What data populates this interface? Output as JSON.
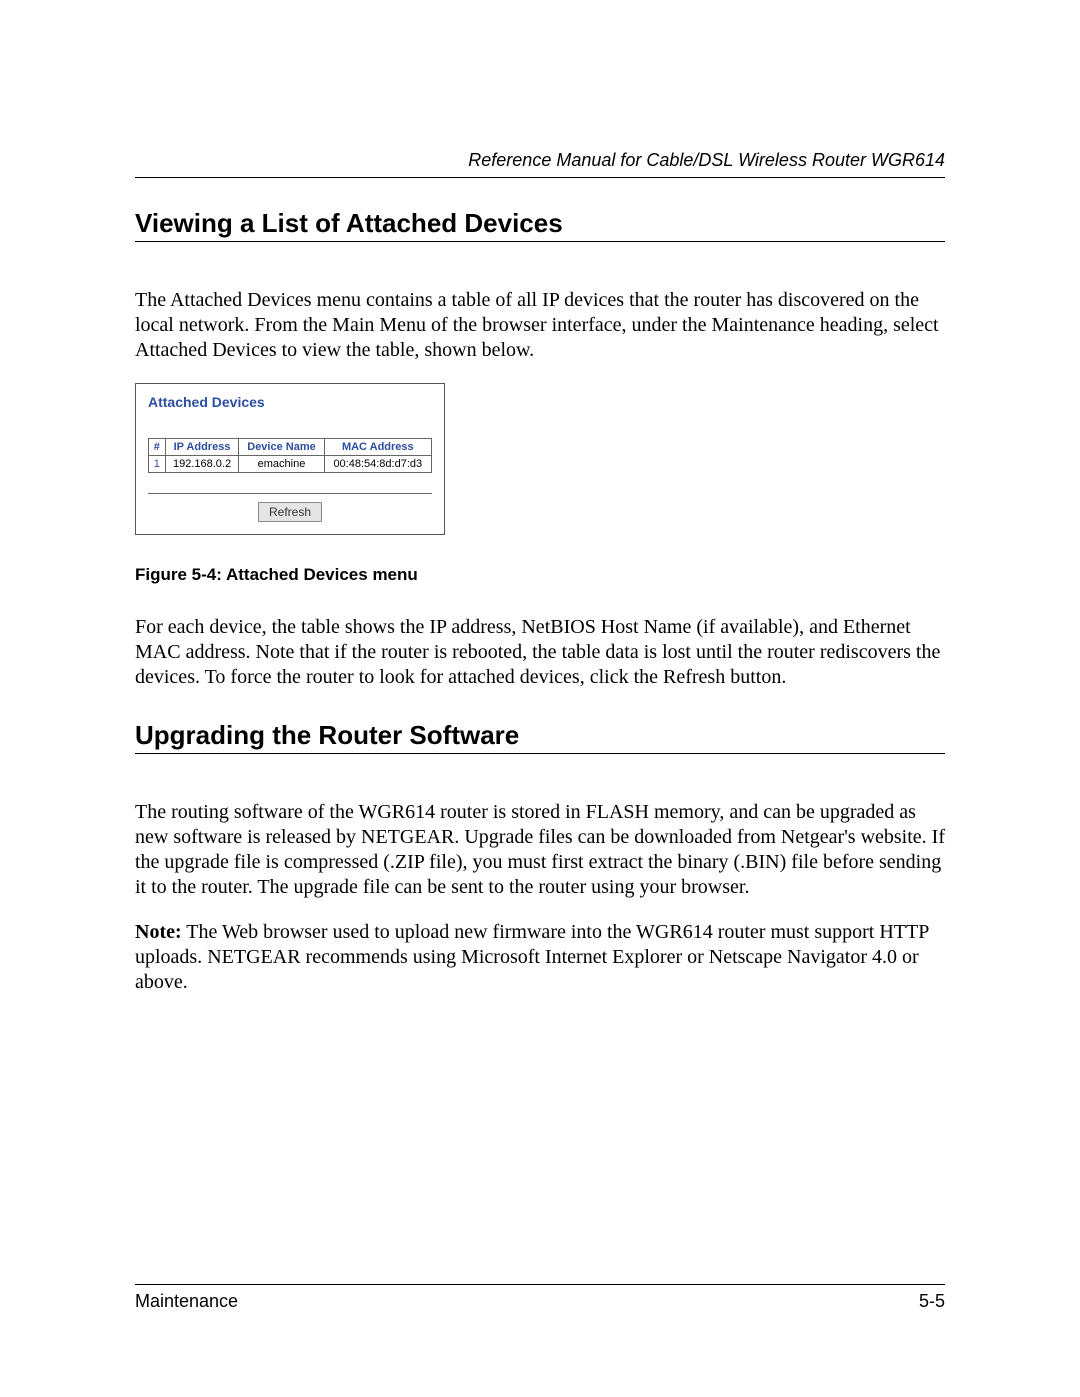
{
  "header": {
    "title": "Reference Manual for Cable/DSL Wireless Router WGR614"
  },
  "section1": {
    "heading": "Viewing a List of Attached Devices",
    "para1": "The Attached Devices menu contains a table of all IP devices that the router has discovered on the local network. From the Main Menu of the browser interface, under the Maintenance heading, select Attached Devices to view the table, shown below.",
    "figure_caption": "Figure 5-4:  Attached Devices menu",
    "para2": "For each device, the table shows the IP address, NetBIOS Host Name (if available), and Ethernet MAC address. Note that if the router is rebooted, the table data is lost until the router rediscovers the devices. To force the router to look for attached devices, click the Refresh button."
  },
  "panel": {
    "title": "Attached Devices",
    "columns": [
      "#",
      "IP Address",
      "Device Name",
      "MAC Address"
    ],
    "row": {
      "num": "1",
      "ip": "192.168.0.2",
      "name": "emachine",
      "mac": "00:48:54:8d:d7:d3"
    },
    "refresh_label": "Refresh"
  },
  "section2": {
    "heading": "Upgrading the Router Software",
    "para1": "The routing software of the WGR614 router is stored in FLASH memory, and can be upgraded as new software is released by NETGEAR. Upgrade files can be downloaded from Netgear's website. If the upgrade file is compressed (.ZIP file), you must first extract the binary (.BIN) file before sending it to the router. The upgrade file can be sent to the router using your browser.",
    "note_label": "Note:",
    "note_body": " The Web browser used to upload new firmware into the WGR614 router must support HTTP uploads. NETGEAR recommends using Microsoft Internet Explorer or Netscape Navigator 4.0 or above."
  },
  "footer": {
    "left": "Maintenance",
    "right": "5-5"
  }
}
